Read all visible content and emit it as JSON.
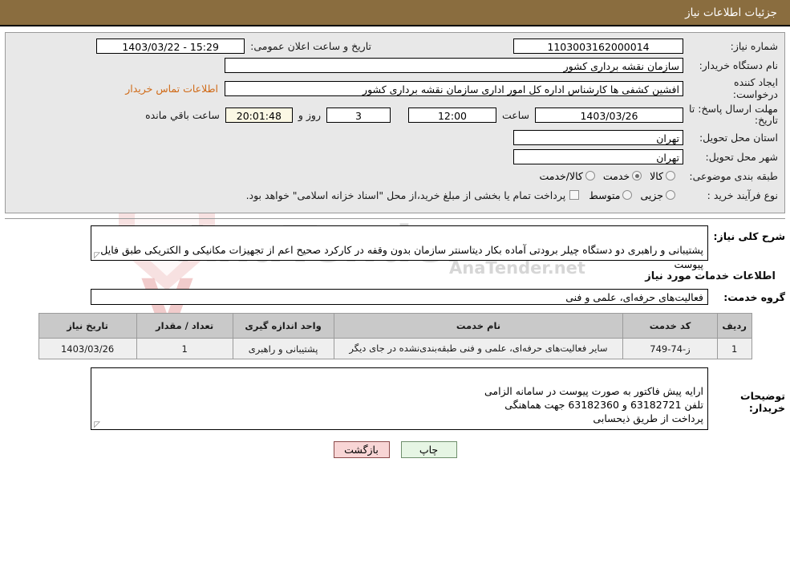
{
  "header": {
    "title": "جزئیات اطلاعات نیاز",
    "bg": "#8a6d3f"
  },
  "watermark": {
    "brand": "AnaTender",
    "suffix": ".net",
    "tagline": "AnaTender.net"
  },
  "form": {
    "need_number": {
      "label": "شماره نیاز:",
      "value": "1103003162000014"
    },
    "announce_datetime": {
      "label": "تاریخ و ساعت اعلان عمومی:",
      "value": "15:29 - 1403/03/22"
    },
    "buyer_org": {
      "label": "نام دستگاه خریدار:",
      "value": "سازمان نقشه برداری کشور"
    },
    "request_creator": {
      "label": "ایجاد کننده درخواست:",
      "value": "افشین کشفی ها کارشناس اداره کل امور اداری سازمان نقشه برداری کشور"
    },
    "contact_link": {
      "label": "اطلاعات تماس خریدار",
      "color": "#d06a17"
    },
    "deadline": {
      "label": "مهلت ارسال پاسخ: تا تاریخ:",
      "date": "1403/03/26",
      "time_label": "ساعت",
      "time": "12:00",
      "days": "3",
      "days_label": "روز و",
      "countdown": "20:01:48",
      "remaining_label": "ساعت باقي مانده"
    },
    "province": {
      "label": "استان محل تحویل:",
      "value": "تهران"
    },
    "city": {
      "label": "شهر محل تحویل:",
      "value": "تهران"
    },
    "category": {
      "label": "طبقه بندی موضوعی:",
      "options": [
        {
          "label": "کالا",
          "selected": false
        },
        {
          "label": "خدمت",
          "selected": true
        },
        {
          "label": "کالا/خدمت",
          "selected": false
        }
      ]
    },
    "process_type": {
      "label": "نوع فرآیند خرید :",
      "options": [
        {
          "label": "جزیی",
          "selected": false
        },
        {
          "label": "متوسط",
          "selected": false
        }
      ],
      "checkbox_label": "پرداخت تمام یا بخشی از مبلغ خرید،از محل \"اسناد خزانه اسلامی\" خواهد بود.",
      "checkbox_checked": false
    },
    "description": {
      "label": "شرح کلی نیاز:",
      "value": "پشتیبانی و راهبری دو دستگاه چیلر برودتی آماده بکار دیتاسنتر سازمان بدون وقفه در کارکرد صحیح اعم از تجهیزات مکانیکی و الکتریکی طبق فایل پیوست"
    },
    "service_group": {
      "label": "گروه خدمت:",
      "value": "فعالیت‌های حرفه‌ای، علمی و فنی"
    },
    "buyer_notes": {
      "label": "توضیحات خریدار:",
      "value": "ارایه پیش فاکتور به صورت پیوست در سامانه الزامی\nتلفن 63182721 و 63182360  جهت هماهنگی\nپرداخت از طریق ذیحسابی"
    }
  },
  "section_heading": "اطلاعات خدمات مورد نیاز",
  "table": {
    "columns": [
      "ردیف",
      "کد خدمت",
      "نام خدمت",
      "واحد اندازه گیری",
      "تعداد / مقدار",
      "تاریخ نیاز"
    ],
    "rows": [
      {
        "radif": "1",
        "code": "ز-74-749",
        "name": "سایر فعالیت‌های حرفه‌ای، علمی و فنی طبقه‌بندی‌نشده در جای دیگر",
        "unit": "پشتیبانی و راهبری",
        "qty": "1",
        "date": "1403/03/26"
      }
    ]
  },
  "buttons": {
    "print": "چاپ",
    "back": "بازگشت"
  }
}
